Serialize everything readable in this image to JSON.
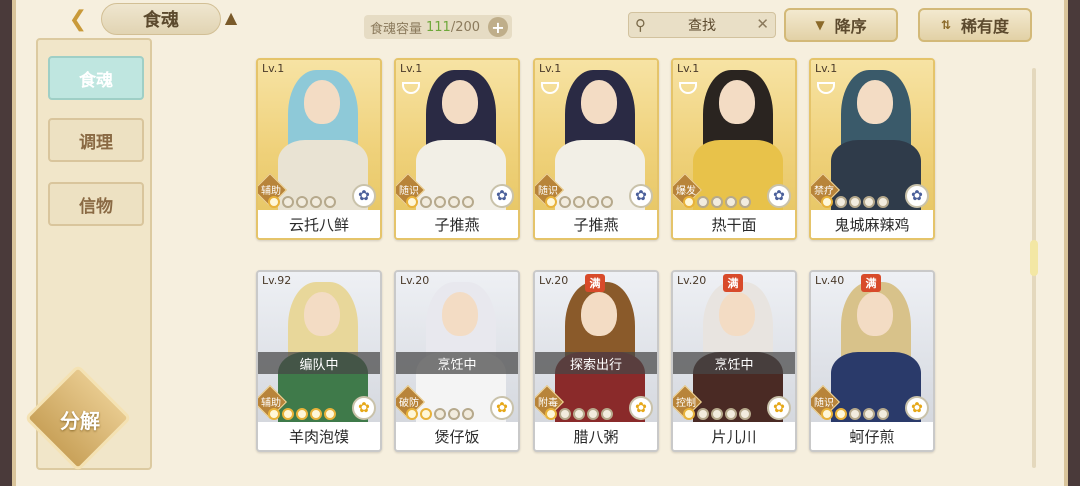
{
  "header": {
    "back_icon": "chevron-left-icon",
    "title": "食魂",
    "hat_icon": "straw-hat-icon",
    "capacity_label": "食魂容量",
    "capacity_current": "111",
    "capacity_total": "/200",
    "search_placeholder": "查找",
    "sort_order_label": "降序",
    "sort_key_label": "稀有度"
  },
  "sidebar": {
    "tabs": [
      {
        "label": "食魂",
        "active": true
      },
      {
        "label": "调理",
        "active": false
      },
      {
        "label": "信物",
        "active": false
      }
    ],
    "decompose_label": "分解"
  },
  "cards": [
    {
      "level": "Lv.1",
      "name": "云托八鲜",
      "role": "辅助",
      "stars": 1,
      "flower": "blue",
      "status": "",
      "man": "",
      "frame": "gold",
      "hair": "#8ec9d8",
      "body": "#e9e3d3"
    },
    {
      "level": "Lv.1",
      "name": "子推燕",
      "role": "随识",
      "stars": 1,
      "flower": "blue",
      "status": "",
      "man": "",
      "frame": "gold",
      "hair": "#2a2a44",
      "body": "#f2efe6"
    },
    {
      "level": "Lv.1",
      "name": "子推燕",
      "role": "随识",
      "stars": 1,
      "flower": "blue",
      "status": "",
      "man": "",
      "frame": "gold",
      "hair": "#2a2a44",
      "body": "#f2efe6"
    },
    {
      "level": "Lv.1",
      "name": "热干面",
      "role": "爆发",
      "stars": 1,
      "flower": "blue",
      "status": "",
      "man": "",
      "frame": "gold",
      "hair": "#2a2420",
      "body": "#e8c24a"
    },
    {
      "level": "Lv.1",
      "name": "鬼城麻辣鸡",
      "role": "禁疗",
      "stars": 1,
      "flower": "blue",
      "status": "",
      "man": "",
      "frame": "gold",
      "hair": "#3a5a6a",
      "body": "#2f3b4a"
    },
    {
      "level": "Lv.92",
      "name": "羊肉泡馍",
      "role": "辅助",
      "stars": 5,
      "flower": "gold",
      "status": "编队中",
      "man": "",
      "frame": "silver",
      "hair": "#e8d79a",
      "body": "#3f7a4a"
    },
    {
      "level": "Lv.20",
      "name": "煲仔饭",
      "role": "破防",
      "stars": 2,
      "flower": "gold",
      "status": "烹饪中",
      "man": "",
      "frame": "silver",
      "hair": "#e8e8ee",
      "body": "#f4f4f4"
    },
    {
      "level": "Lv.20",
      "name": "腊八粥",
      "role": "附毒",
      "stars": 1,
      "flower": "gold",
      "status": "探索出行",
      "man": "满",
      "frame": "silver",
      "hair": "#8a5a2a",
      "body": "#8a2a2a"
    },
    {
      "level": "Lv.20",
      "name": "片儿川",
      "role": "控制",
      "stars": 1,
      "flower": "gold",
      "status": "烹饪中",
      "man": "满",
      "frame": "silver",
      "hair": "#e8e4e0",
      "body": "#4a2a24"
    },
    {
      "level": "Lv.40",
      "name": "蚵仔煎",
      "role": "随识",
      "stars": 2,
      "flower": "gold",
      "status": "",
      "man": "满",
      "frame": "silver",
      "hair": "#d8c28a",
      "body": "#2a3a6a"
    }
  ]
}
